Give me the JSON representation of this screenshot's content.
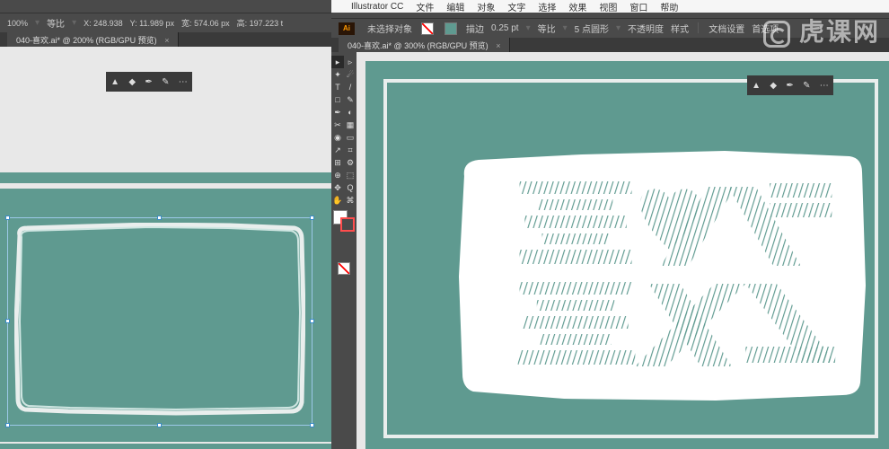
{
  "mac_menu": {
    "app": "Illustrator CC",
    "items": [
      "文件",
      "编辑",
      "对象",
      "文字",
      "选择",
      "效果",
      "视图",
      "窗口",
      "帮助"
    ]
  },
  "options_left": {
    "zoom": "100%",
    "label1": "等比",
    "x": "248.938",
    "y": "11.989 px",
    "w": "574.06 px",
    "h": "197.223 t"
  },
  "options_right": {
    "doc_setup": "未选择对象",
    "stroke_label": "描边",
    "stroke_val": "0.25 pt",
    "uniform": "等比",
    "profile": "5 点圆形",
    "opacity_label": "不透明度",
    "style": "样式",
    "doc_btn": "文档设置",
    "prefs_btn": "首选项"
  },
  "tab_left": {
    "title": "040-喜欢.ai* @ 200% (RGB/GPU 预览)"
  },
  "tab_right": {
    "title": "040-喜欢.ai* @ 300% (RGB/GPU 预览)"
  },
  "floating_toolbar_icons": [
    "▲",
    "◆",
    "✒",
    "✎",
    "⋯"
  ],
  "tools": [
    [
      "▸",
      "▹"
    ],
    [
      "✦",
      "☄"
    ],
    [
      "T",
      "/"
    ],
    [
      "□",
      "✎"
    ],
    [
      "✒",
      "◐"
    ],
    [
      "✂",
      "▦"
    ],
    [
      "◉",
      "▭"
    ],
    [
      "↗",
      "⌗"
    ],
    [
      "⊞",
      "⚙"
    ],
    [
      "⊕",
      "⬚"
    ],
    [
      "✥",
      "Q"
    ],
    [
      "✋",
      "⌘"
    ]
  ],
  "watermark": "虎课网",
  "colors": {
    "teal": "#5f9a90",
    "cream": "#e9eeed"
  }
}
